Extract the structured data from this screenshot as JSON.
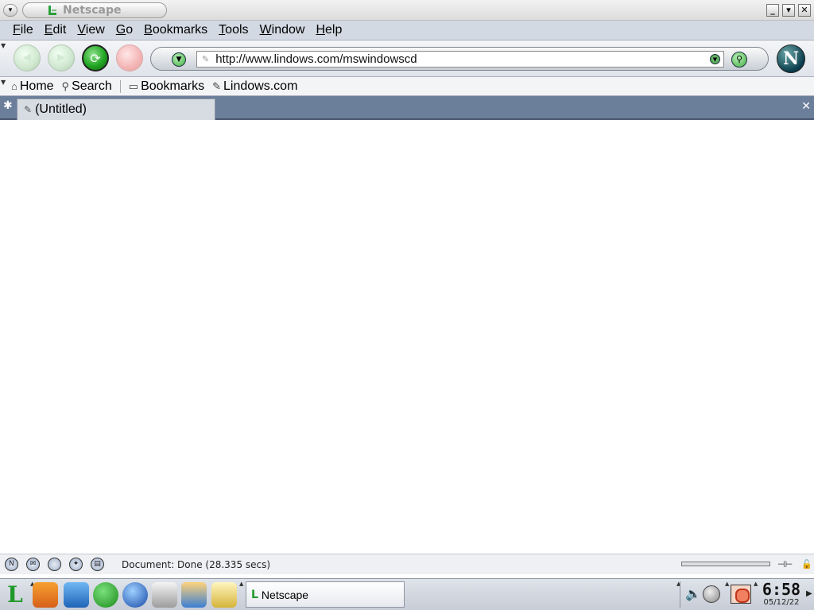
{
  "window": {
    "title": "Netscape",
    "buttons": {
      "minimize": "_",
      "maximize": "▾",
      "close": "✕"
    }
  },
  "menubar": {
    "items": [
      "File",
      "Edit",
      "View",
      "Go",
      "Bookmarks",
      "Tools",
      "Window",
      "Help"
    ]
  },
  "navbar": {
    "url": "http://www.lindows.com/mswindowscd",
    "logo_letter": "N"
  },
  "personal_toolbar": {
    "items": [
      {
        "label": "Home",
        "icon": "home-icon"
      },
      {
        "label": "Search",
        "icon": "search-icon"
      },
      {
        "label": "Bookmarks",
        "icon": "folder-icon"
      },
      {
        "label": "Lindows.com",
        "icon": "page-icon"
      }
    ]
  },
  "tabs": {
    "items": [
      {
        "label": "(Untitled)"
      }
    ],
    "new_tab_glyph": "✱",
    "close_glyph": "✕"
  },
  "statusbar": {
    "text": "Document: Done (28.335 secs)"
  },
  "taskbar": {
    "task_label": "Netscape",
    "clock_time": "6:58",
    "clock_date": "05/12/22"
  }
}
